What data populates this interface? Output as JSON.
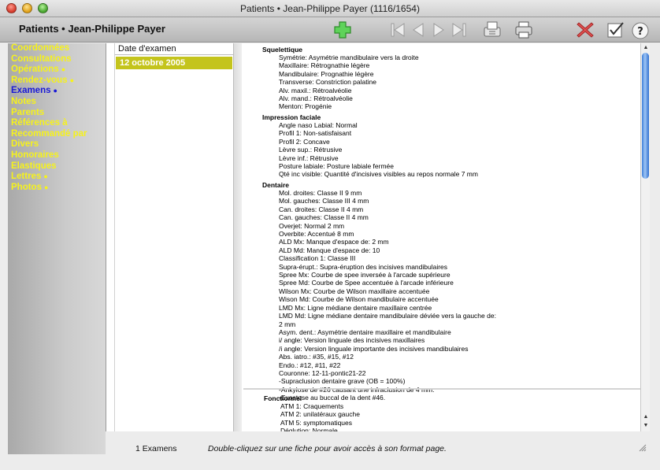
{
  "window": {
    "title": "Patients • Jean-Philippe Payer (1116/1654)"
  },
  "toolbar": {
    "patient_name": "Patients • Jean-Philippe Payer",
    "icons": [
      "add-icon",
      "first-record-icon",
      "previous-record-icon",
      "next-record-icon",
      "last-record-icon",
      "fax-icon",
      "print-icon",
      "delete-icon",
      "validate-icon",
      "help-icon"
    ]
  },
  "nav": {
    "items": [
      {
        "label": "Coordonnées",
        "dot": ""
      },
      {
        "label": "Consultations",
        "dot": ""
      },
      {
        "label": "Opérations",
        "dot": "●"
      },
      {
        "label": "Rendez-vous",
        "dot": "●"
      },
      {
        "label": "Examens",
        "dot": "●",
        "active": true
      },
      {
        "label": "Notes",
        "dot": ""
      },
      {
        "label": "Parents",
        "dot": ""
      },
      {
        "label": "Références à",
        "dot": ""
      },
      {
        "label": "Recommandé par",
        "dot": ""
      },
      {
        "label": "Divers",
        "dot": ""
      },
      {
        "label": "Honoraires",
        "dot": ""
      },
      {
        "label": "Élastiques",
        "dot": ""
      },
      {
        "label": "Lettres",
        "dot": "●"
      },
      {
        "label": "Photos",
        "dot": "●"
      }
    ]
  },
  "exam_list": {
    "header": "Date d'examen",
    "rows": [
      "12 octobre 2005"
    ]
  },
  "detail": {
    "sections": [
      {
        "title": "Squelettique",
        "lines": [
          "Symétrie: Asymétrie mandibulaire vers la droite",
          "Maxillaire: Rétrognathie légère",
          "Mandibulaire: Prognathie légère",
          "Transverse: Constriction palatine",
          "Alv. maxil.: Rétroalvéolie",
          "Alv. mand.: Rétroalvéolie",
          "Menton: Progénie"
        ]
      },
      {
        "title": "Impression faciale",
        "lines": [
          "Angle naso Labial: Normal",
          "Profil 1: Non-satisfaisant",
          "Profil 2: Concave",
          "Lèvre sup.: Rétrusive",
          "Lèvre inf.: Rétrusive",
          "Posture labiale: Posture labiale fermée",
          "Qté inc visible: Quantité d'incisives visibles au repos normale 7 mm"
        ]
      },
      {
        "title": "Dentaire",
        "lines": [
          "Mol. droites: Classe II 9 mm",
          "Mol. gauches: Classe III 4 mm",
          "Can. droites: Classe II 4 mm",
          "Can. gauches: Classe II 4 mm",
          "Overjet: Normal 2 mm",
          "Overbite: Accentué 8 mm",
          "ALD Mx: Manque d'espace de: 2 mm",
          "ALD Md: Manque d'espace de: 10",
          "Classification 1: Classe III",
          "Supra-érupt.: Supra-éruption des incisives mandibulaires",
          "Spree Mx: Courbe de spee inversée à l'arcade supérieure",
          "Spree Md: Courbe de Spee accentuée à l'arcade inférieure",
          "Wilson Mx: Courbe de Wilson maxillaire accentuée",
          "Wison Md: Courbe de Wilson mandibulaire accentuée",
          "LMD Mx: Ligne médiane dentaire maxillaire centrée",
          "LMD Md: Ligne médiane dentaire mandibulaire déviée vers la gauche de:",
          "2 mm",
          "Asym. dent.: Asymétrie dentaire maxillaire et mandibulaire",
          "i/ angle: Version linguale des incisives maxillaires",
          "/i angle: Version linguale importante des incisives mandibulaires",
          "Abs. iatro.: #35, #15, #12",
          "Endo.: #12, #11, #22",
          "Couronne: 12-11-pontic21-22",
          "-Supraclusion dentaire grave (OB = 100%)",
          "-Ankylose de #26 causant une infraclusion de 4 mm.",
          "-Exostose au buccal de la dent #46."
        ]
      },
      {
        "title": "Fonctionnel",
        "lines": [
          "ATM 1: Craquements",
          "ATM 2: unilatéraux gauche",
          "ATM 5: symptomatiques",
          "Déglution: Normale"
        ]
      }
    ]
  },
  "status": {
    "count": "1 Examens",
    "hint": "Double-cliquez sur une fiche pour avoir accès à son format page."
  },
  "colors": {
    "nav_text": "#f6f21c",
    "nav_active": "#1919d6",
    "selection": "#c4c41c",
    "scroll_thumb": "#3e7fd9"
  }
}
